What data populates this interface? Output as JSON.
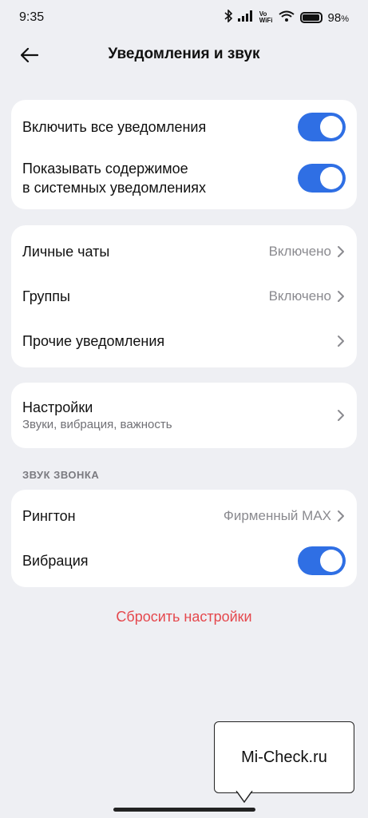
{
  "status_bar": {
    "time": "9:35",
    "net_top": "Vo",
    "net_bottom": "WiFi",
    "battery_percent": "98",
    "battery_unit": "%",
    "battery_level": 0.98
  },
  "header": {
    "title": "Уведомления и звук"
  },
  "notifications_card": {
    "enable_all_label": "Включить все уведомления",
    "enable_all_on": true,
    "show_content_label_line1": "Показывать содержимое",
    "show_content_label_line2": "в системных уведомлениях",
    "show_content_on": true
  },
  "chats_card": {
    "items": [
      {
        "label": "Личные чаты",
        "value": "Включено"
      },
      {
        "label": "Группы",
        "value": "Включено"
      },
      {
        "label": "Прочие уведомления",
        "value": ""
      }
    ]
  },
  "settings_card": {
    "label": "Настройки",
    "sublabel": "Звуки, вибрация, важность"
  },
  "ringtone_section": {
    "title": "ЗВУК ЗВОНКА",
    "ringtone_label": "Рингтон",
    "ringtone_value": "Фирменный MAX",
    "vibration_label": "Вибрация",
    "vibration_on": true
  },
  "reset_label": "Сбросить настройки",
  "watermark": "Mi-Check.ru",
  "colors": {
    "accent": "#2f6fe4",
    "danger": "#e5484d",
    "background": "#eeeff3"
  }
}
